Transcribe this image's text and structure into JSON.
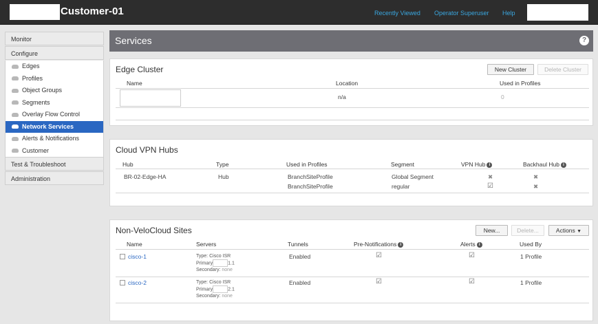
{
  "topbar": {
    "title": "Customer-01",
    "nav": [
      "Recently Viewed",
      "Operator Superuser",
      "Help"
    ]
  },
  "sidebar": {
    "monitor": "Monitor",
    "configure": "Configure",
    "items": [
      "Edges",
      "Profiles",
      "Object Groups",
      "Segments",
      "Overlay Flow Control",
      "Network Services",
      "Alerts & Notifications",
      "Customer"
    ],
    "test": "Test & Troubleshoot",
    "admin": "Administration"
  },
  "services": {
    "title": "Services",
    "help": "?"
  },
  "edge_cluster": {
    "title": "Edge Cluster",
    "new_btn": "New Cluster",
    "delete_btn": "Delete Cluster",
    "headers": [
      "Name",
      "Location",
      "Used in Profiles"
    ],
    "row": {
      "location": "n/a",
      "used": "0"
    }
  },
  "vpn_hubs": {
    "title": "Cloud VPN Hubs",
    "headers": [
      "Hub",
      "Type",
      "Used in Profiles",
      "Segment",
      "VPN Hub",
      "Backhaul Hub"
    ],
    "row": {
      "hub": "BR-02-Edge-HA",
      "type": "Hub",
      "profiles": [
        "BranchSiteProfile",
        "BranchSiteProfile"
      ],
      "segments": [
        "Global Segment",
        "regular"
      ],
      "vpn": [
        "✖",
        "☑"
      ],
      "backhaul": [
        "✖",
        "✖"
      ]
    }
  },
  "nvs": {
    "title": "Non-VeloCloud Sites",
    "new_btn": "New...",
    "delete_btn": "Delete...",
    "actions_btn": "Actions",
    "headers": [
      "Name",
      "Servers",
      "Tunnels",
      "Pre-Notifications",
      "Alerts",
      "Used By"
    ],
    "rows": [
      {
        "name": "cisco-1",
        "type_label": "Type:",
        "type": "Cisco ISR",
        "primary_label": "Primary",
        "primary": "1.1",
        "secondary_label": "Secondary:",
        "secondary": "none",
        "tunnels": "Enabled",
        "prenot": "☑",
        "alerts": "☑",
        "used": "1 Profile"
      },
      {
        "name": "cisco-2",
        "type_label": "Type:",
        "type": "Cisco ISR",
        "primary_label": "Primary",
        "primary": "2.1",
        "secondary_label": "Secondary:",
        "secondary": "none",
        "tunnels": "Enabled",
        "prenot": "☑",
        "alerts": "☑",
        "used": "1 Profile"
      }
    ]
  }
}
